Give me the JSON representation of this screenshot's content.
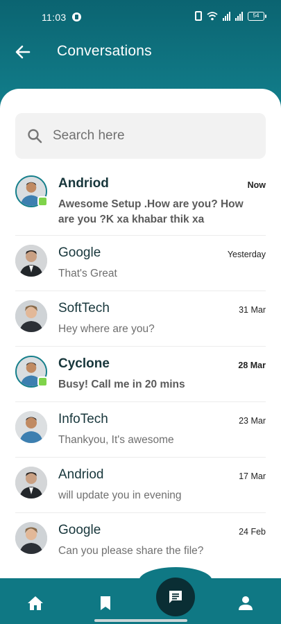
{
  "status_bar": {
    "time": "11:03",
    "battery": "54"
  },
  "header": {
    "title": "Conversations"
  },
  "search": {
    "placeholder": "Search here"
  },
  "conversations": [
    {
      "name": "Andriod",
      "time": "Now",
      "message": "Awesome Setup .How are you? How are you ?K xa khabar thik xa",
      "unread": true,
      "online": true
    },
    {
      "name": "Google",
      "time": "Yesterday",
      "message": "That's Great",
      "unread": false,
      "online": false
    },
    {
      "name": "SoftTech",
      "time": "31 Mar",
      "message": "Hey where are you?",
      "unread": false,
      "online": false
    },
    {
      "name": "Cyclone",
      "time": "28 Mar",
      "message": "Busy! Call me in 20 mins",
      "unread": true,
      "online": true
    },
    {
      "name": "InfoTech",
      "time": "23 Mar",
      "message": "Thankyou, It's awesome",
      "unread": false,
      "online": false
    },
    {
      "name": "Andriod",
      "time": "17 Mar",
      "message": "will update you in evening",
      "unread": false,
      "online": false
    },
    {
      "name": "Google",
      "time": "24 Feb",
      "message": "Can you please share the file?",
      "unread": false,
      "online": false
    }
  ],
  "bottom_nav": {
    "items": [
      "home-icon",
      "bookmark-icon",
      "chat-icon",
      "profile-icon"
    ],
    "active": "chat-icon"
  },
  "colors": {
    "primary": "#0f7884",
    "online": "#7fd34a",
    "fab": "#0a2e34"
  }
}
